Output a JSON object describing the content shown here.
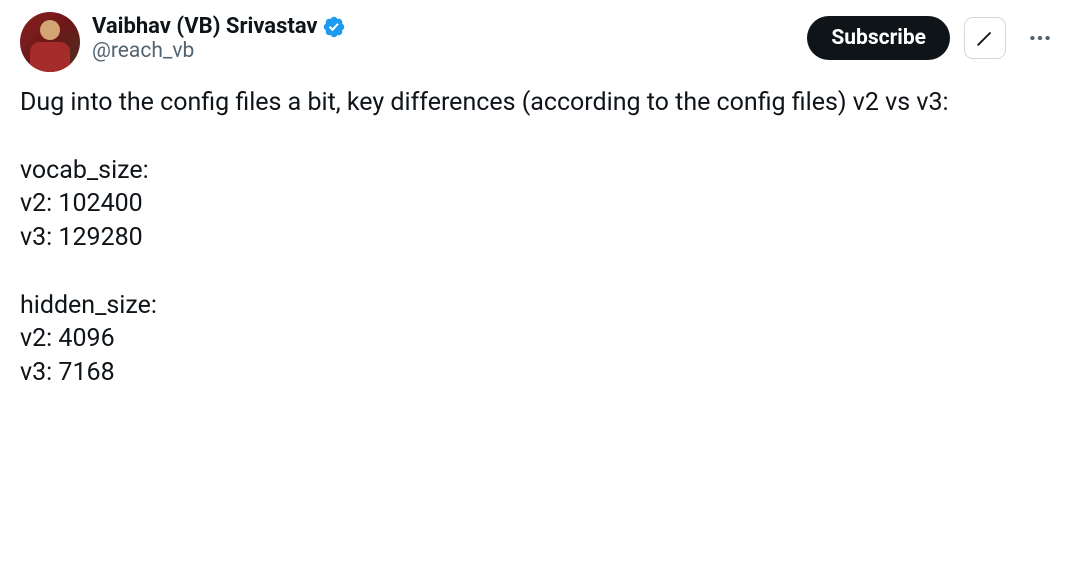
{
  "user": {
    "display_name": "Vaibhav (VB) Srivastav",
    "handle": "@reach_vb",
    "verified": true
  },
  "actions": {
    "subscribe_label": "Subscribe"
  },
  "tweet": {
    "lines": [
      "Dug into the config files a bit, key differences (according to the config files) v2 vs v3:",
      "",
      "vocab_size:",
      "v2: 102400",
      "v3: 129280",
      "",
      "hidden_size:",
      "v2: 4096",
      "v3: 7168"
    ]
  }
}
